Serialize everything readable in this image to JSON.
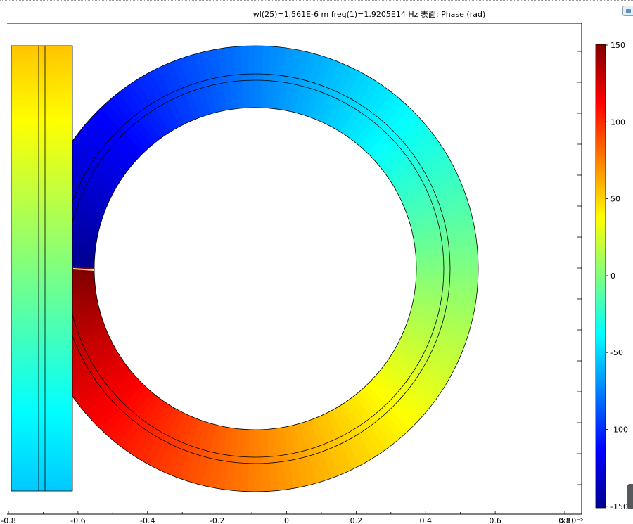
{
  "plot": {
    "title": "wl(25)=1.561E-6 m freq(1)=1.9205E14 Hz   表面: Phase (rad)",
    "x_axis": {
      "tick_labels": [
        "-0.8",
        "-0.6",
        "-0.4",
        "-0.2",
        "0",
        "0.2",
        "0.4",
        "0.6",
        "0.8"
      ],
      "exponent_label": "×10⁻⁵"
    }
  },
  "colorbar": {
    "tick_labels": [
      "150",
      "100",
      "50",
      "0",
      "-50",
      "-100",
      "-150"
    ],
    "range": [
      -150,
      150
    ],
    "colormap": [
      "#00008f",
      "#0000ff",
      "#00ffff",
      "#7fff7f",
      "#ffff00",
      "#ff0000",
      "#800000"
    ]
  },
  "colors": {
    "background": "#ffffff",
    "frame": "#000000"
  },
  "icons": {
    "toolbar": "toolbar-button-icon",
    "scroll": "scroll-handle"
  }
}
